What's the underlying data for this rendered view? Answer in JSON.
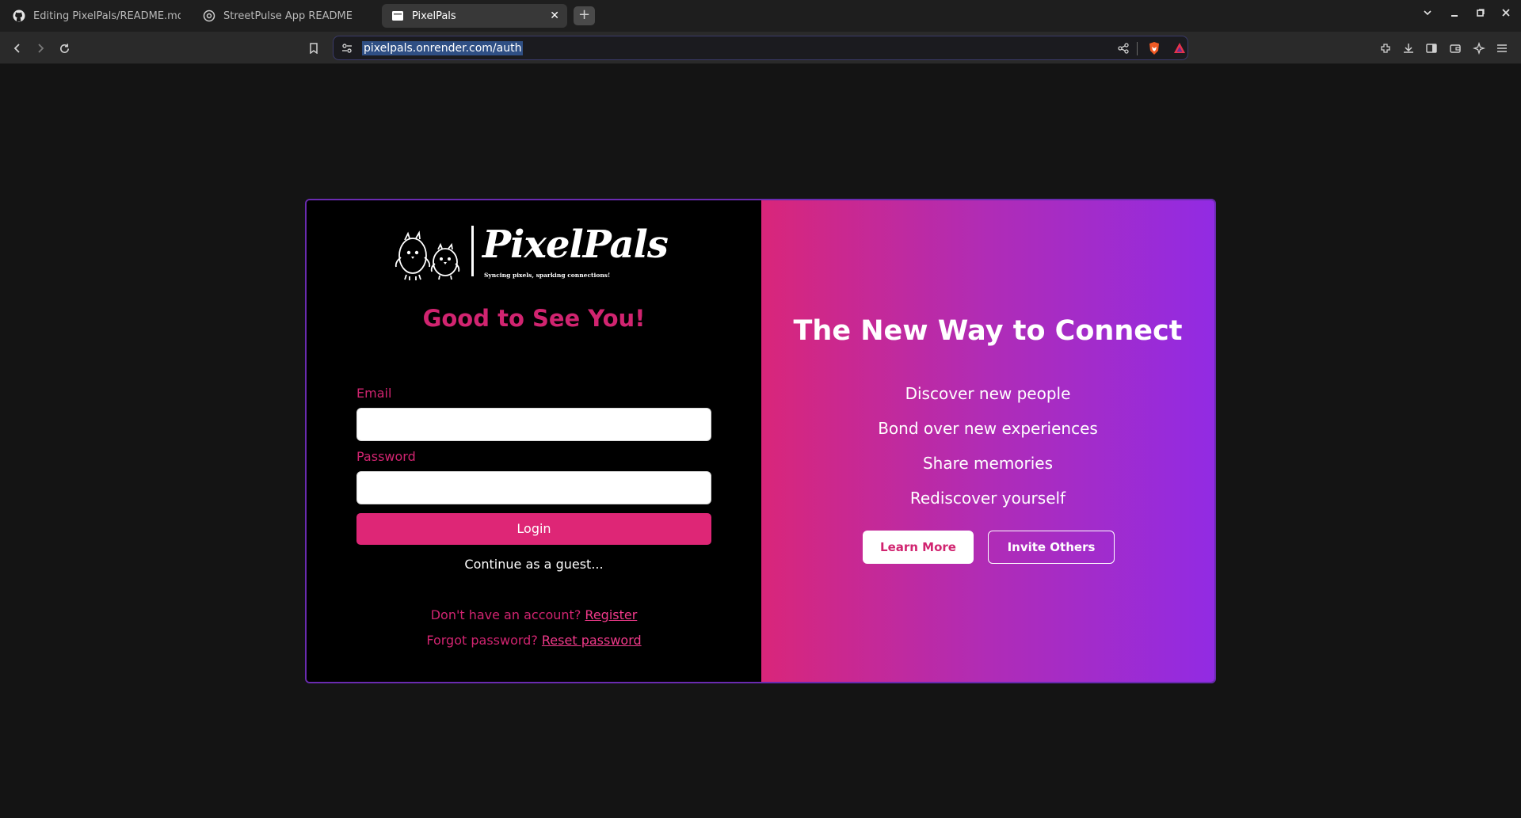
{
  "browser": {
    "tabs": [
      {
        "title": "Editing PixelPals/README.md at",
        "icon": "github-icon"
      },
      {
        "title": "StreetPulse App README",
        "icon": "chrome-like-icon"
      },
      {
        "title": "PixelPals",
        "icon": "page-icon",
        "active": true
      }
    ],
    "new_tab_label": "+",
    "url": "pixelpals.onrender.com/auth"
  },
  "auth": {
    "logo_text": "PixelPals",
    "logo_tagline": "Syncing pixels, sparking connections!",
    "greeting": "Good to See You!",
    "email_label": "Email",
    "email_value": "",
    "password_label": "Password",
    "password_value": "",
    "login_label": "Login",
    "guest_label": "Continue as a guest...",
    "no_account_text": "Don't have an account?",
    "register_label": "Register",
    "forgot_text": "Forgot password?",
    "reset_label": "Reset password"
  },
  "promo": {
    "headline": "The New Way to Connect",
    "features": [
      "Discover new people",
      "Bond over new experiences",
      "Share memories",
      "Rediscover yourself"
    ],
    "learn_more_label": "Learn More",
    "invite_label": "Invite Others"
  },
  "colors": {
    "accent": "#d12470",
    "gradient_start": "#d9267a",
    "gradient_end": "#922be3"
  }
}
